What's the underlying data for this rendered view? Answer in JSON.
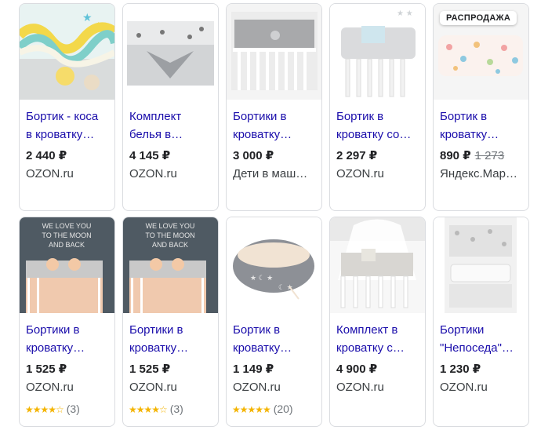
{
  "accent_color": "#1a0dab",
  "star_color": "#f4b400",
  "products": [
    {
      "title_line1": "Бортик - коса",
      "title_line2": "в кроватку…",
      "price": "2 440 ₽",
      "store": "OZON.ru"
    },
    {
      "title_line1": "Комплект",
      "title_line2": "белья в…",
      "price": "4 145 ₽",
      "store": "OZON.ru"
    },
    {
      "title_line1": "Бортики в",
      "title_line2": "кроватку…",
      "price": "3 000 ₽",
      "store": "Дети в маш…"
    },
    {
      "title_line1": "Бортик в",
      "title_line2": "кроватку со…",
      "price": "2 297 ₽",
      "store": "OZON.ru"
    },
    {
      "title_line1": "Бортик в",
      "title_line2": "кроватку…",
      "price": "890 ₽",
      "old_price": "1 273",
      "store": "Яндекс.Мар…",
      "badge": "РАСПРОДАЖА"
    },
    {
      "title_line1": "Бортики в",
      "title_line2": "кроватку…",
      "price": "1 525 ₽",
      "store": "OZON.ru",
      "rating_count": "(3)",
      "rating_value": 4.5
    },
    {
      "title_line1": "Бортики в",
      "title_line2": "кроватку…",
      "price": "1 525 ₽",
      "store": "OZON.ru",
      "rating_count": "(3)",
      "rating_value": 4.5
    },
    {
      "title_line1": "Бортик в",
      "title_line2": "кроватку…",
      "price": "1 149 ₽",
      "store": "OZON.ru",
      "rating_count": "(20)",
      "rating_value": 5
    },
    {
      "title_line1": "Комплект в",
      "title_line2": "кроватку с…",
      "price": "4 900 ₽",
      "store": "OZON.ru"
    },
    {
      "title_line1": "Бортики",
      "title_line2": "\"Непоседа\"…",
      "price": "1 230 ₽",
      "store": "OZON.ru"
    }
  ],
  "image_texts": {
    "wall_line1": "WE LOVE YOU",
    "wall_line2": "TO THE MOON",
    "wall_line3": "AND BACK"
  }
}
